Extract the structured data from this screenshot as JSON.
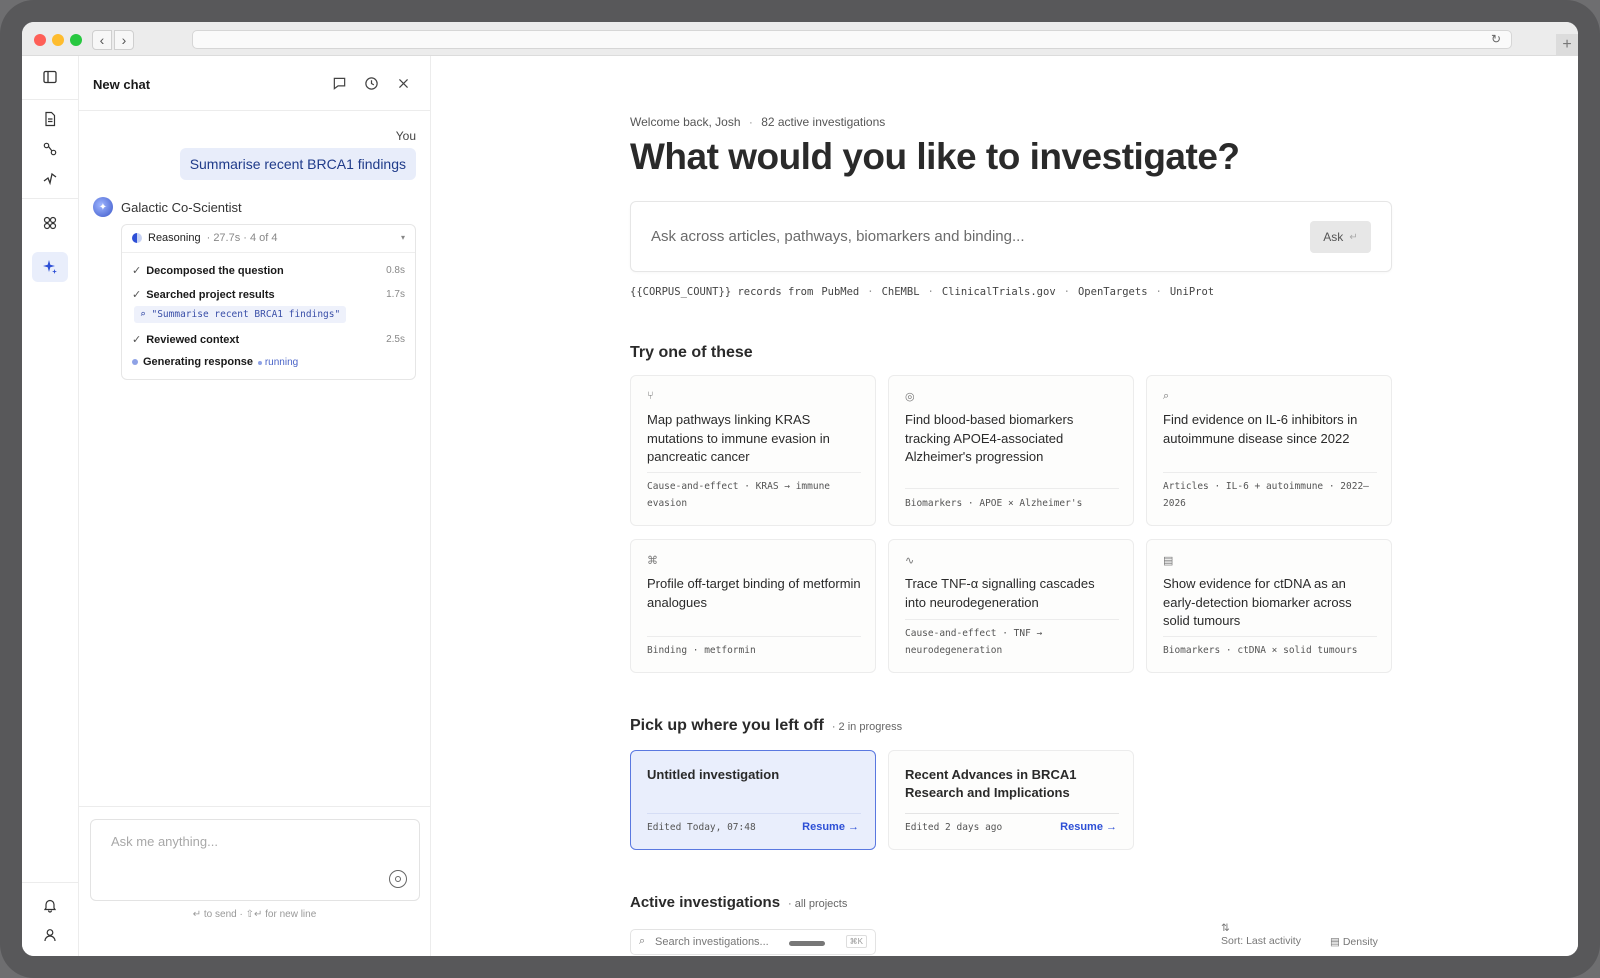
{
  "browser": {
    "url": ""
  },
  "rail": {
    "items": [
      "sidebar-toggle-icon",
      "document-icon",
      "pathway-icon",
      "sparkline-icon",
      "binding-icon",
      "sparkle-icon"
    ],
    "bottom": [
      "bell-icon",
      "user-icon"
    ]
  },
  "chat": {
    "title": "New chat",
    "you_label": "You",
    "user_message": "Summarise recent BRCA1 findings",
    "assistant_name": "Galactic Co-Scientist",
    "reasoning": {
      "title": "Reasoning",
      "meta": "· 27.7s · 4 of 4",
      "steps": [
        {
          "label": "Decomposed the question",
          "time": "0.8s"
        },
        {
          "label": "Searched project results",
          "time": "1.7s"
        },
        {
          "label": "Reviewed context",
          "time": "2.5s"
        },
        {
          "label": "Generating response",
          "status": "running"
        }
      ],
      "query_chip": "\"Summarise recent BRCA1 findings\""
    },
    "composer": {
      "placeholder": "Ask me anything...",
      "hint": "↵ to send · ⇧↵ for new line"
    }
  },
  "main": {
    "welcome": "Welcome back, Josh",
    "welcome_sep": "·",
    "active_count": "82 active investigations",
    "headline": "What would you like to investigate?",
    "ask": {
      "placeholder": "Ask across articles, pathways, biomarkers and binding...",
      "button": "Ask",
      "button_hint": "↵"
    },
    "sources": {
      "prefix": "{{CORPUS_COUNT}} records from",
      "list": [
        "PubMed",
        "ChEMBL",
        "ClinicalTrials.gov",
        "OpenTargets",
        "UniProt"
      ]
    },
    "try": {
      "title": "Try one of these",
      "cards": [
        {
          "icon": "branch-icon",
          "glyph": "⑂",
          "title": "Map pathways linking KRAS mutations to immune evasion in pancreatic cancer",
          "tags": "Cause-and-effect · KRAS → immune evasion"
        },
        {
          "icon": "target-icon",
          "glyph": "◎",
          "title": "Find blood-based biomarkers tracking APOE4-associated Alzheimer's progression",
          "tags": "Biomarkers · APOE × Alzheimer's"
        },
        {
          "icon": "search-icon",
          "glyph": "⌕",
          "title": "Find evidence on IL-6 inhibitors in autoimmune disease since 2022",
          "tags": "Articles · IL-6 + autoimmune · 2022–2026"
        },
        {
          "icon": "binding-icon",
          "glyph": "⌘",
          "title": "Profile off-target binding of metformin analogues",
          "tags": "Binding · metformin"
        },
        {
          "icon": "pulse-icon",
          "glyph": "∿",
          "title": "Trace TNF-α signalling cascades into neurodegeneration",
          "tags": "Cause-and-effect · TNF → neurodegeneration"
        },
        {
          "icon": "document-icon",
          "glyph": "▤",
          "title": "Show evidence for ctDNA as an early-detection biomarker across solid tumours",
          "tags": "Biomarkers · ctDNA × solid tumours"
        }
      ]
    },
    "pickup": {
      "title": "Pick up where you left off",
      "meta": "· 2 in progress",
      "items": [
        {
          "title": "Untitled investigation",
          "edited": "Edited Today, 07:48",
          "action": "Resume →"
        },
        {
          "title": "Recent Advances in BRCA1 Research and Implications",
          "edited": "Edited 2 days ago",
          "action": "Resume →"
        }
      ]
    },
    "active": {
      "title": "Active investigations",
      "meta": "· all projects",
      "search_placeholder": "Search investigations...",
      "search_kbd": "⌘K",
      "sort_icon": "⇅",
      "sort": "Sort: Last activity",
      "density_icon": "▤",
      "density": "Density"
    }
  }
}
